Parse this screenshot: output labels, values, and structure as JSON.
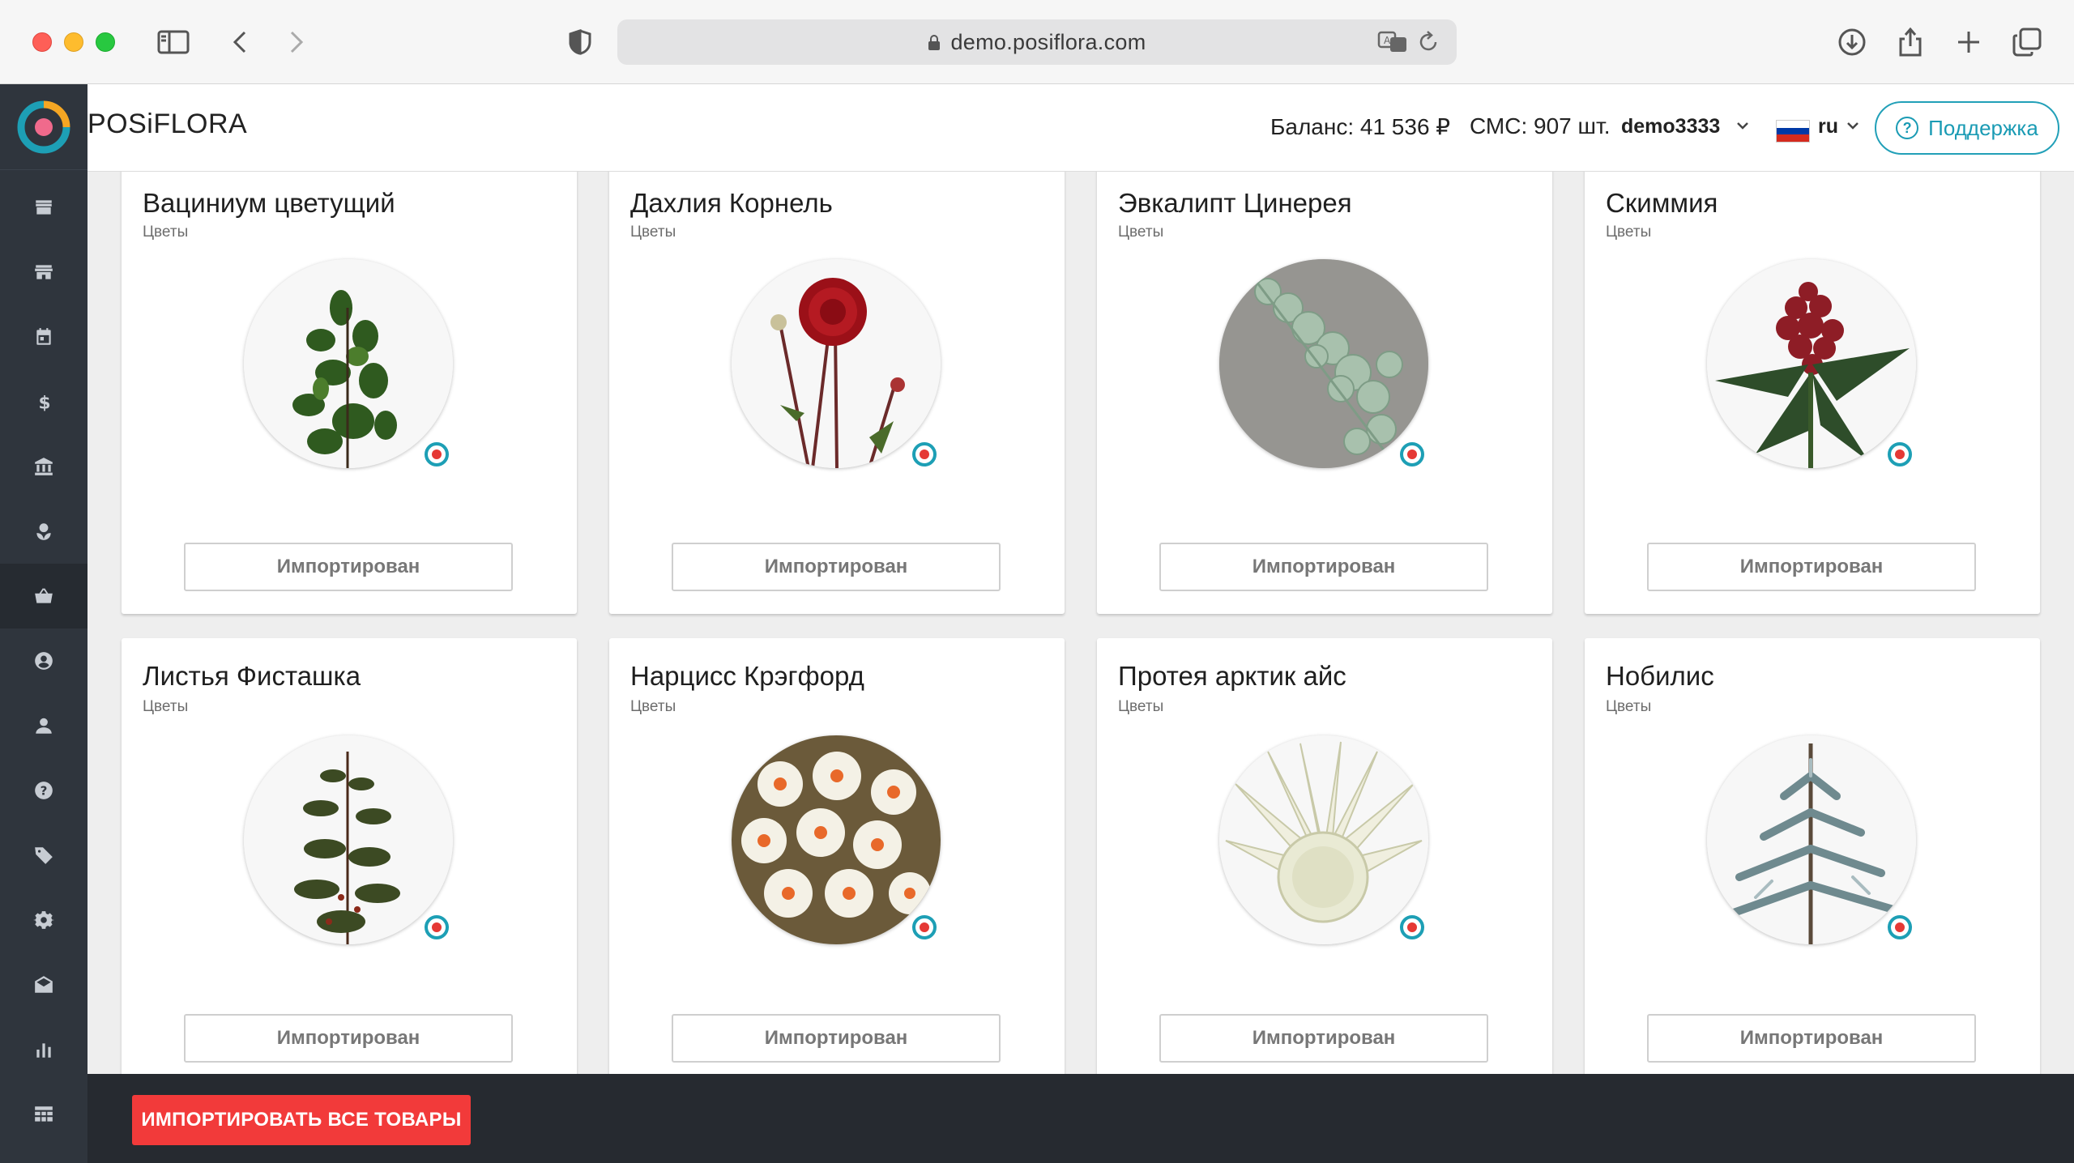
{
  "browser": {
    "url": "demo.posiflora.com"
  },
  "app": {
    "brand": "POSiFLORA"
  },
  "header": {
    "balance": "Баланс: 41 536 ₽",
    "sms": "СМС: 907 шт.",
    "user": "demo3333",
    "language": "ru",
    "support_label": "Поддержка"
  },
  "sidebar": {
    "items": [
      {
        "icon": "store-icon"
      },
      {
        "icon": "store-alt-icon"
      },
      {
        "icon": "calendar-icon"
      },
      {
        "icon": "dollar-icon"
      },
      {
        "icon": "bank-icon"
      },
      {
        "icon": "plant-icon"
      },
      {
        "icon": "basket-icon",
        "active": true
      },
      {
        "icon": "account-circle-icon"
      },
      {
        "icon": "person-icon"
      },
      {
        "icon": "help-icon"
      },
      {
        "icon": "tag-icon"
      },
      {
        "icon": "settings-icon"
      },
      {
        "icon": "mail-open-icon"
      },
      {
        "icon": "bar-chart-icon"
      },
      {
        "icon": "table-icon"
      }
    ]
  },
  "products": [
    {
      "name": "Вациниум цветущий",
      "category": "Цветы",
      "button": "Импортирован"
    },
    {
      "name": "Дахлия Корнель",
      "category": "Цветы",
      "button": "Импортирован"
    },
    {
      "name": "Эвкалипт Цинерея",
      "category": "Цветы",
      "button": "Импортирован"
    },
    {
      "name": "Скиммия",
      "category": "Цветы",
      "button": "Импортирован"
    },
    {
      "name": "Листья Фисташка",
      "category": "Цветы",
      "button": "Импортирован"
    },
    {
      "name": "Нарцисс Крэгфорд",
      "category": "Цветы",
      "button": "Импортирован"
    },
    {
      "name": "Протея арктик айс",
      "category": "Цветы",
      "button": "Импортирован"
    },
    {
      "name": "Нобилис",
      "category": "Цветы",
      "button": "Импортирован"
    }
  ],
  "footer": {
    "import_all_label": "ИМПОРТИРОВАТЬ ВСЕ ТОВАРЫ"
  },
  "colors": {
    "accent": "#1d9fb5",
    "danger": "#f23a3a",
    "sidebar": "#2f353d"
  }
}
